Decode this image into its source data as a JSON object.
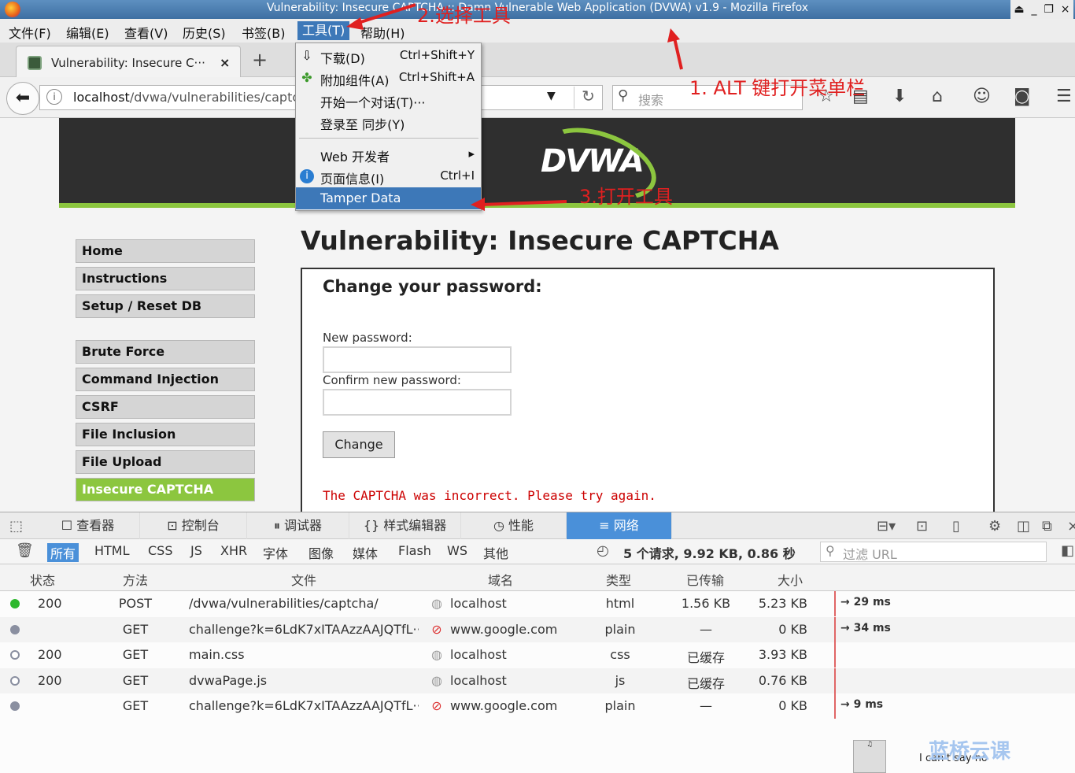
{
  "window": {
    "title": "Vulnerability: Insecure CAPTCHA :: Damn Vulnerable Web Application (DVWA) v1.9 - Mozilla Firefox"
  },
  "menubar": {
    "items": [
      "文件(F)",
      "编辑(E)",
      "查看(V)",
      "历史(S)",
      "书签(B)",
      "工具(T)",
      "帮助(H)"
    ],
    "active_index": 5
  },
  "tab": {
    "label": "Vulnerability: Insecure C···",
    "close": "×",
    "newtab": "+"
  },
  "navbar": {
    "url_host": "localhost",
    "url_path": "/dvwa/vulnerabilities/captc",
    "search_placeholder": "搜索"
  },
  "tools_menu": {
    "items": [
      {
        "icon": "download-icon",
        "label": "下载(D)",
        "shortcut": "Ctrl+Shift+Y"
      },
      {
        "icon": "puzzle-icon",
        "label": "附加组件(A)",
        "shortcut": "Ctrl+Shift+A"
      },
      {
        "icon": "",
        "label": "开始一个对话(T)···",
        "shortcut": ""
      },
      {
        "icon": "",
        "label": "登录至 同步(Y)",
        "shortcut": ""
      },
      {
        "icon": "",
        "label": "Web 开发者",
        "shortcut": "▸"
      },
      {
        "icon": "info-icon",
        "label": "页面信息(I)",
        "shortcut": "Ctrl+I"
      },
      {
        "icon": "",
        "label": "Tamper Data",
        "shortcut": ""
      }
    ],
    "highlighted_index": 6
  },
  "annotations": {
    "step1": "1. ALT 键打开菜单栏",
    "step2": "2.选择工具",
    "step3": "3.打开工具"
  },
  "dvwa": {
    "logo": "DVWA",
    "sidebar": {
      "items": [
        "Home",
        "Instructions",
        "Setup / Reset DB",
        "Brute Force",
        "Command Injection",
        "CSRF",
        "File Inclusion",
        "File Upload",
        "Insecure CAPTCHA"
      ],
      "active": "Insecure CAPTCHA"
    },
    "page_title": "Vulnerability: Insecure CAPTCHA",
    "form": {
      "title": "Change your password:",
      "new_label": "New password:",
      "confirm_label": "Confirm new password:",
      "new_value": "",
      "confirm_value": "",
      "button": "Change",
      "error": "The CAPTCHA was incorrect. Please try again."
    }
  },
  "devtools": {
    "tabs": [
      "查看器",
      "控制台",
      "调试器",
      "样式编辑器",
      "性能",
      "网络"
    ],
    "active_tab": "网络",
    "filters": [
      "所有",
      "HTML",
      "CSS",
      "JS",
      "XHR",
      "字体",
      "图像",
      "媒体",
      "Flash",
      "WS",
      "其他"
    ],
    "active_filter": "所有",
    "summary": "5 个请求, 9.92 KB, 0.86 秒",
    "filter_placeholder": "过滤 URL",
    "columns": [
      "状态",
      "方法",
      "文件",
      "域名",
      "类型",
      "已传输",
      "大小"
    ],
    "rows": [
      {
        "status_color": "#2eb82e",
        "status_kind": "filled",
        "status": "200",
        "method": "POST",
        "file": "/dvwa/vulnerabilities/captcha/",
        "domain_icon": "globe-icon",
        "domain": "localhost",
        "type": "html",
        "transferred": "1.56 KB",
        "size": "5.23 KB",
        "timing": "→ 29 ms"
      },
      {
        "status_color": "#8a8fa0",
        "status_kind": "filled",
        "status": "",
        "method": "GET",
        "file": "challenge?k=6LdK7xITAAzzAAJQTfL···",
        "domain_icon": "blocked-icon",
        "domain": "www.google.com",
        "type": "plain",
        "transferred": "—",
        "size": "0 KB",
        "timing": "→ 34 ms"
      },
      {
        "status_color": "#8a8fa0",
        "status_kind": "hollow",
        "status": "200",
        "method": "GET",
        "file": "main.css",
        "domain_icon": "globe-icon",
        "domain": "localhost",
        "type": "css",
        "transferred": "已缓存",
        "size": "3.93 KB",
        "timing": ""
      },
      {
        "status_color": "#8a8fa0",
        "status_kind": "hollow",
        "status": "200",
        "method": "GET",
        "file": "dvwaPage.js",
        "domain_icon": "globe-icon",
        "domain": "localhost",
        "type": "js",
        "transferred": "已缓存",
        "size": "0.76 KB",
        "timing": ""
      },
      {
        "status_color": "#8a8fa0",
        "status_kind": "filled",
        "status": "",
        "method": "GET",
        "file": "challenge?k=6LdK7xITAAzzAAJQTfL···",
        "domain_icon": "blocked-icon",
        "domain": "www.google.com",
        "type": "plain",
        "transferred": "—",
        "size": "0 KB",
        "timing": "→ 9 ms"
      }
    ]
  },
  "overlay": {
    "watermark": "蓝桥云课",
    "thumb_caption": "I can't say no"
  }
}
